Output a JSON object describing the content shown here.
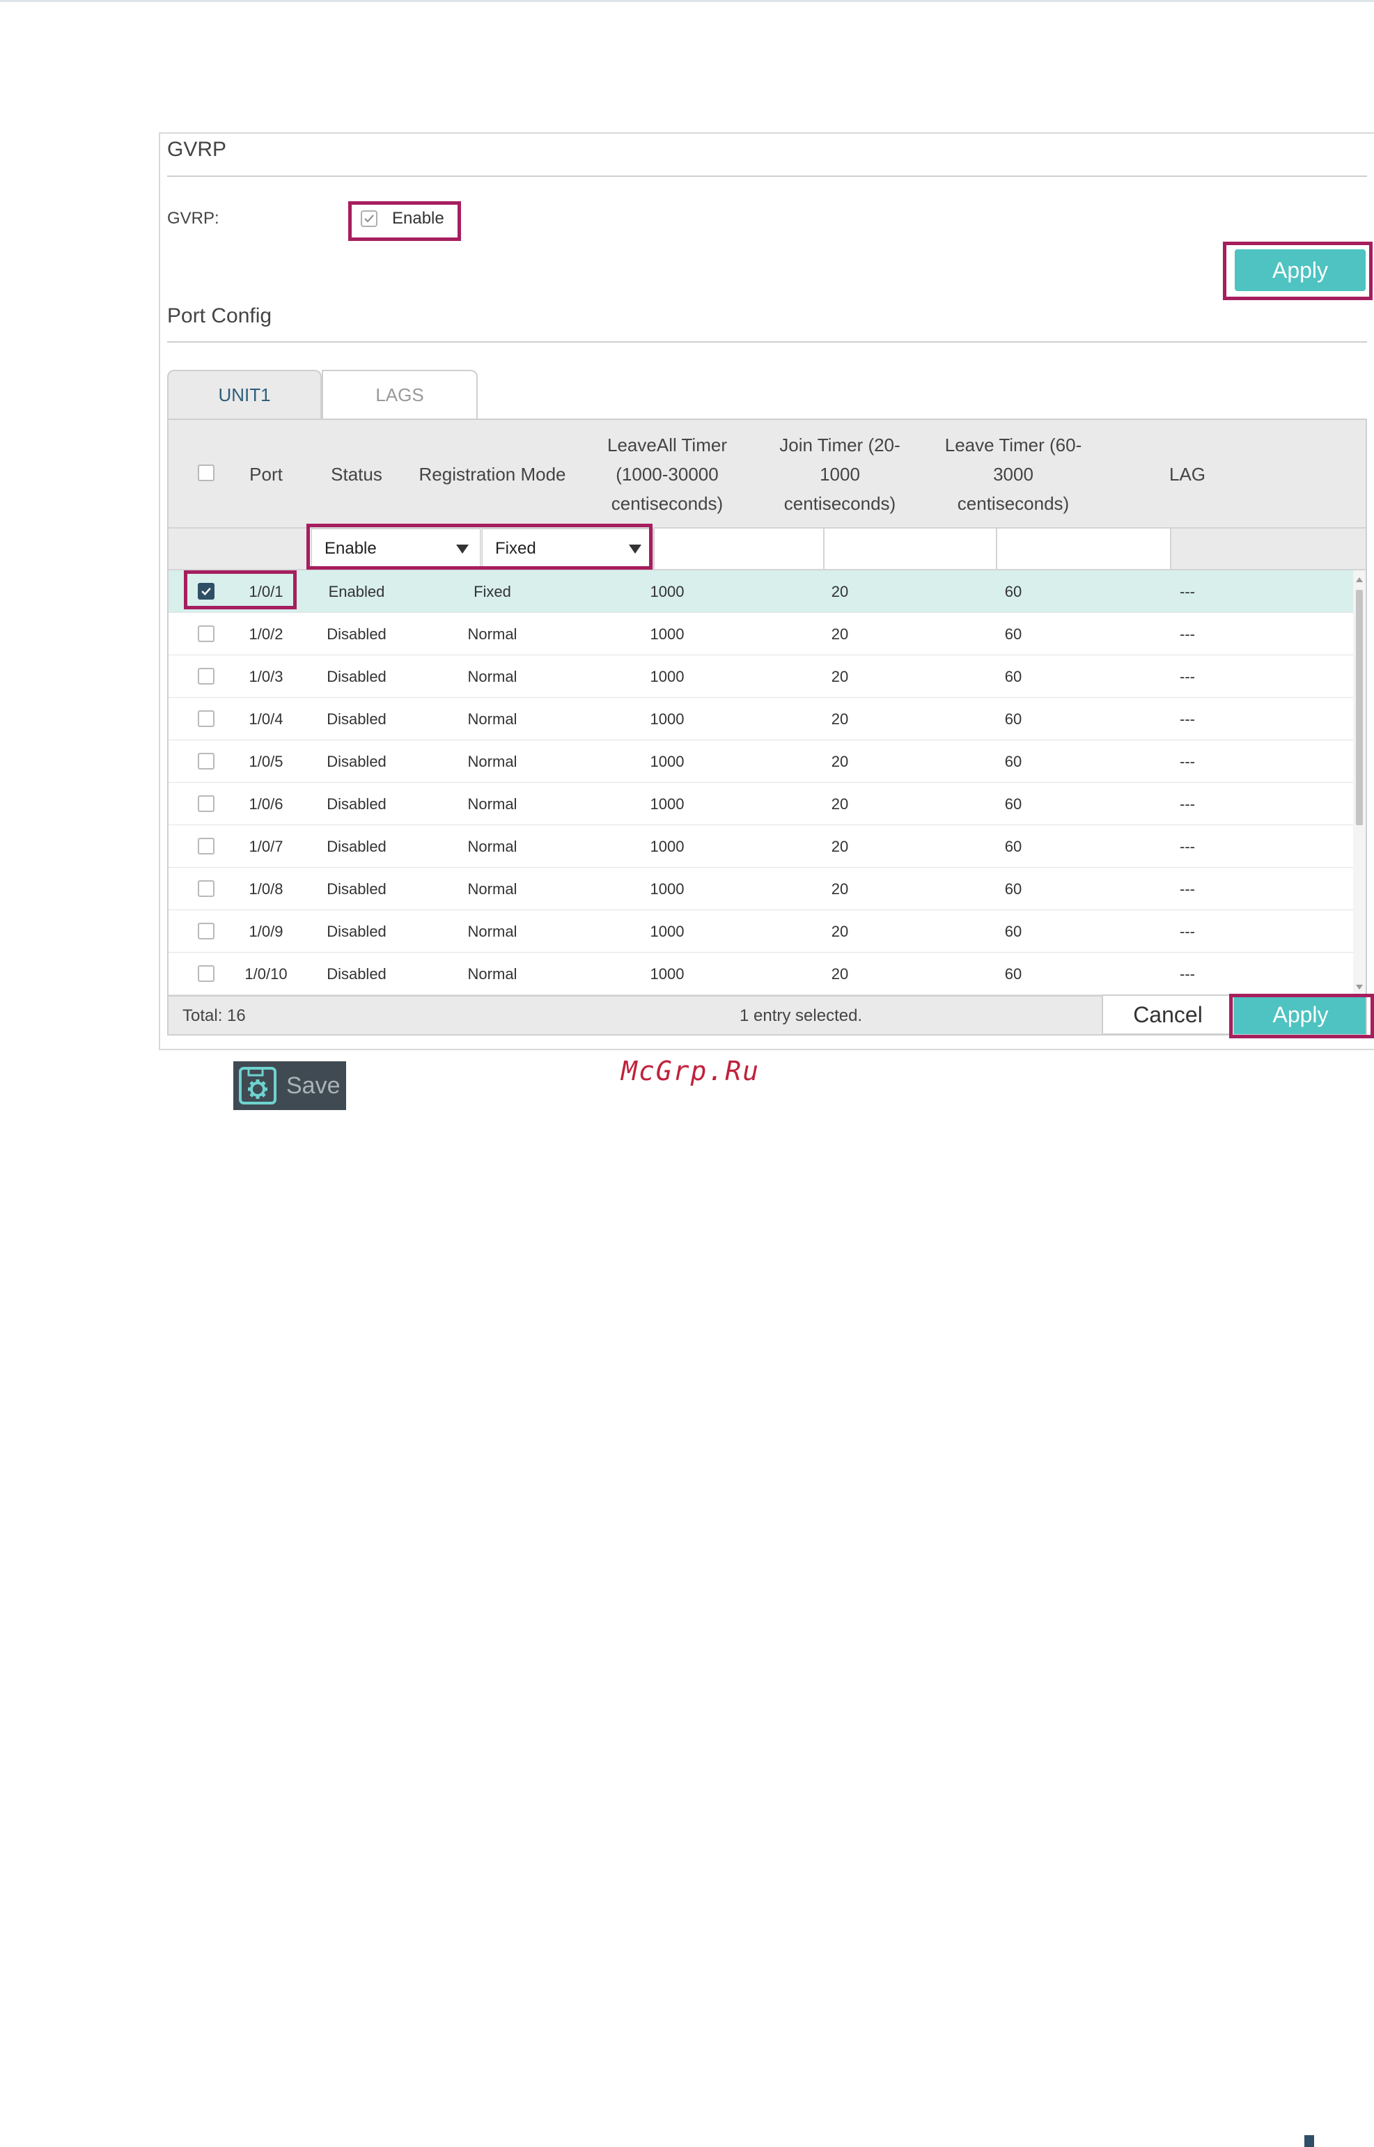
{
  "gvrp_section": {
    "title": "GVRP",
    "field_label": "GVRP:",
    "enable_checked": true,
    "enable_label": "Enable",
    "apply_label": "Apply"
  },
  "port_config": {
    "title": "Port Config",
    "tabs": [
      "UNIT1",
      "LAGS"
    ],
    "active_tab": "UNIT1",
    "columns": {
      "port": "Port",
      "status": "Status",
      "registration_mode": "Registration Mode",
      "leaveall_timer": [
        "LeaveAll Timer",
        "(1000-30000",
        "centiseconds)"
      ],
      "join_timer": [
        "Join Timer (20-",
        "1000",
        "centiseconds)"
      ],
      "leave_timer": [
        "Leave Timer (60-",
        "3000",
        "centiseconds)"
      ],
      "lag": "LAG"
    },
    "filter": {
      "status_value": "Enable",
      "registration_mode_value": "Fixed"
    },
    "rows": [
      {
        "checked": true,
        "port": "1/0/1",
        "status": "Enabled",
        "mode": "Fixed",
        "leaveall": "1000",
        "join": "20",
        "leave": "60",
        "lag": "---"
      },
      {
        "checked": false,
        "port": "1/0/2",
        "status": "Disabled",
        "mode": "Normal",
        "leaveall": "1000",
        "join": "20",
        "leave": "60",
        "lag": "---"
      },
      {
        "checked": false,
        "port": "1/0/3",
        "status": "Disabled",
        "mode": "Normal",
        "leaveall": "1000",
        "join": "20",
        "leave": "60",
        "lag": "---"
      },
      {
        "checked": false,
        "port": "1/0/4",
        "status": "Disabled",
        "mode": "Normal",
        "leaveall": "1000",
        "join": "20",
        "leave": "60",
        "lag": "---"
      },
      {
        "checked": false,
        "port": "1/0/5",
        "status": "Disabled",
        "mode": "Normal",
        "leaveall": "1000",
        "join": "20",
        "leave": "60",
        "lag": "---"
      },
      {
        "checked": false,
        "port": "1/0/6",
        "status": "Disabled",
        "mode": "Normal",
        "leaveall": "1000",
        "join": "20",
        "leave": "60",
        "lag": "---"
      },
      {
        "checked": false,
        "port": "1/0/7",
        "status": "Disabled",
        "mode": "Normal",
        "leaveall": "1000",
        "join": "20",
        "leave": "60",
        "lag": "---"
      },
      {
        "checked": false,
        "port": "1/0/8",
        "status": "Disabled",
        "mode": "Normal",
        "leaveall": "1000",
        "join": "20",
        "leave": "60",
        "lag": "---"
      },
      {
        "checked": false,
        "port": "1/0/9",
        "status": "Disabled",
        "mode": "Normal",
        "leaveall": "1000",
        "join": "20",
        "leave": "60",
        "lag": "---"
      },
      {
        "checked": false,
        "port": "1/0/10",
        "status": "Disabled",
        "mode": "Normal",
        "leaveall": "1000",
        "join": "20",
        "leave": "60",
        "lag": "---"
      }
    ],
    "footer": {
      "total": "Total: 16",
      "selection": "1 entry selected.",
      "cancel_label": "Cancel",
      "apply_label": "Apply"
    }
  },
  "save": {
    "label": "Save",
    "icon": "save-gear-icon"
  },
  "watermark": "McGrp.Ru",
  "colors": {
    "accent": "#4ec3c1",
    "highlight_border": "#a61e5e",
    "selected_row": "#d8efec",
    "checkbox_checked": "#2f4f66",
    "watermark": "#c0213b"
  }
}
